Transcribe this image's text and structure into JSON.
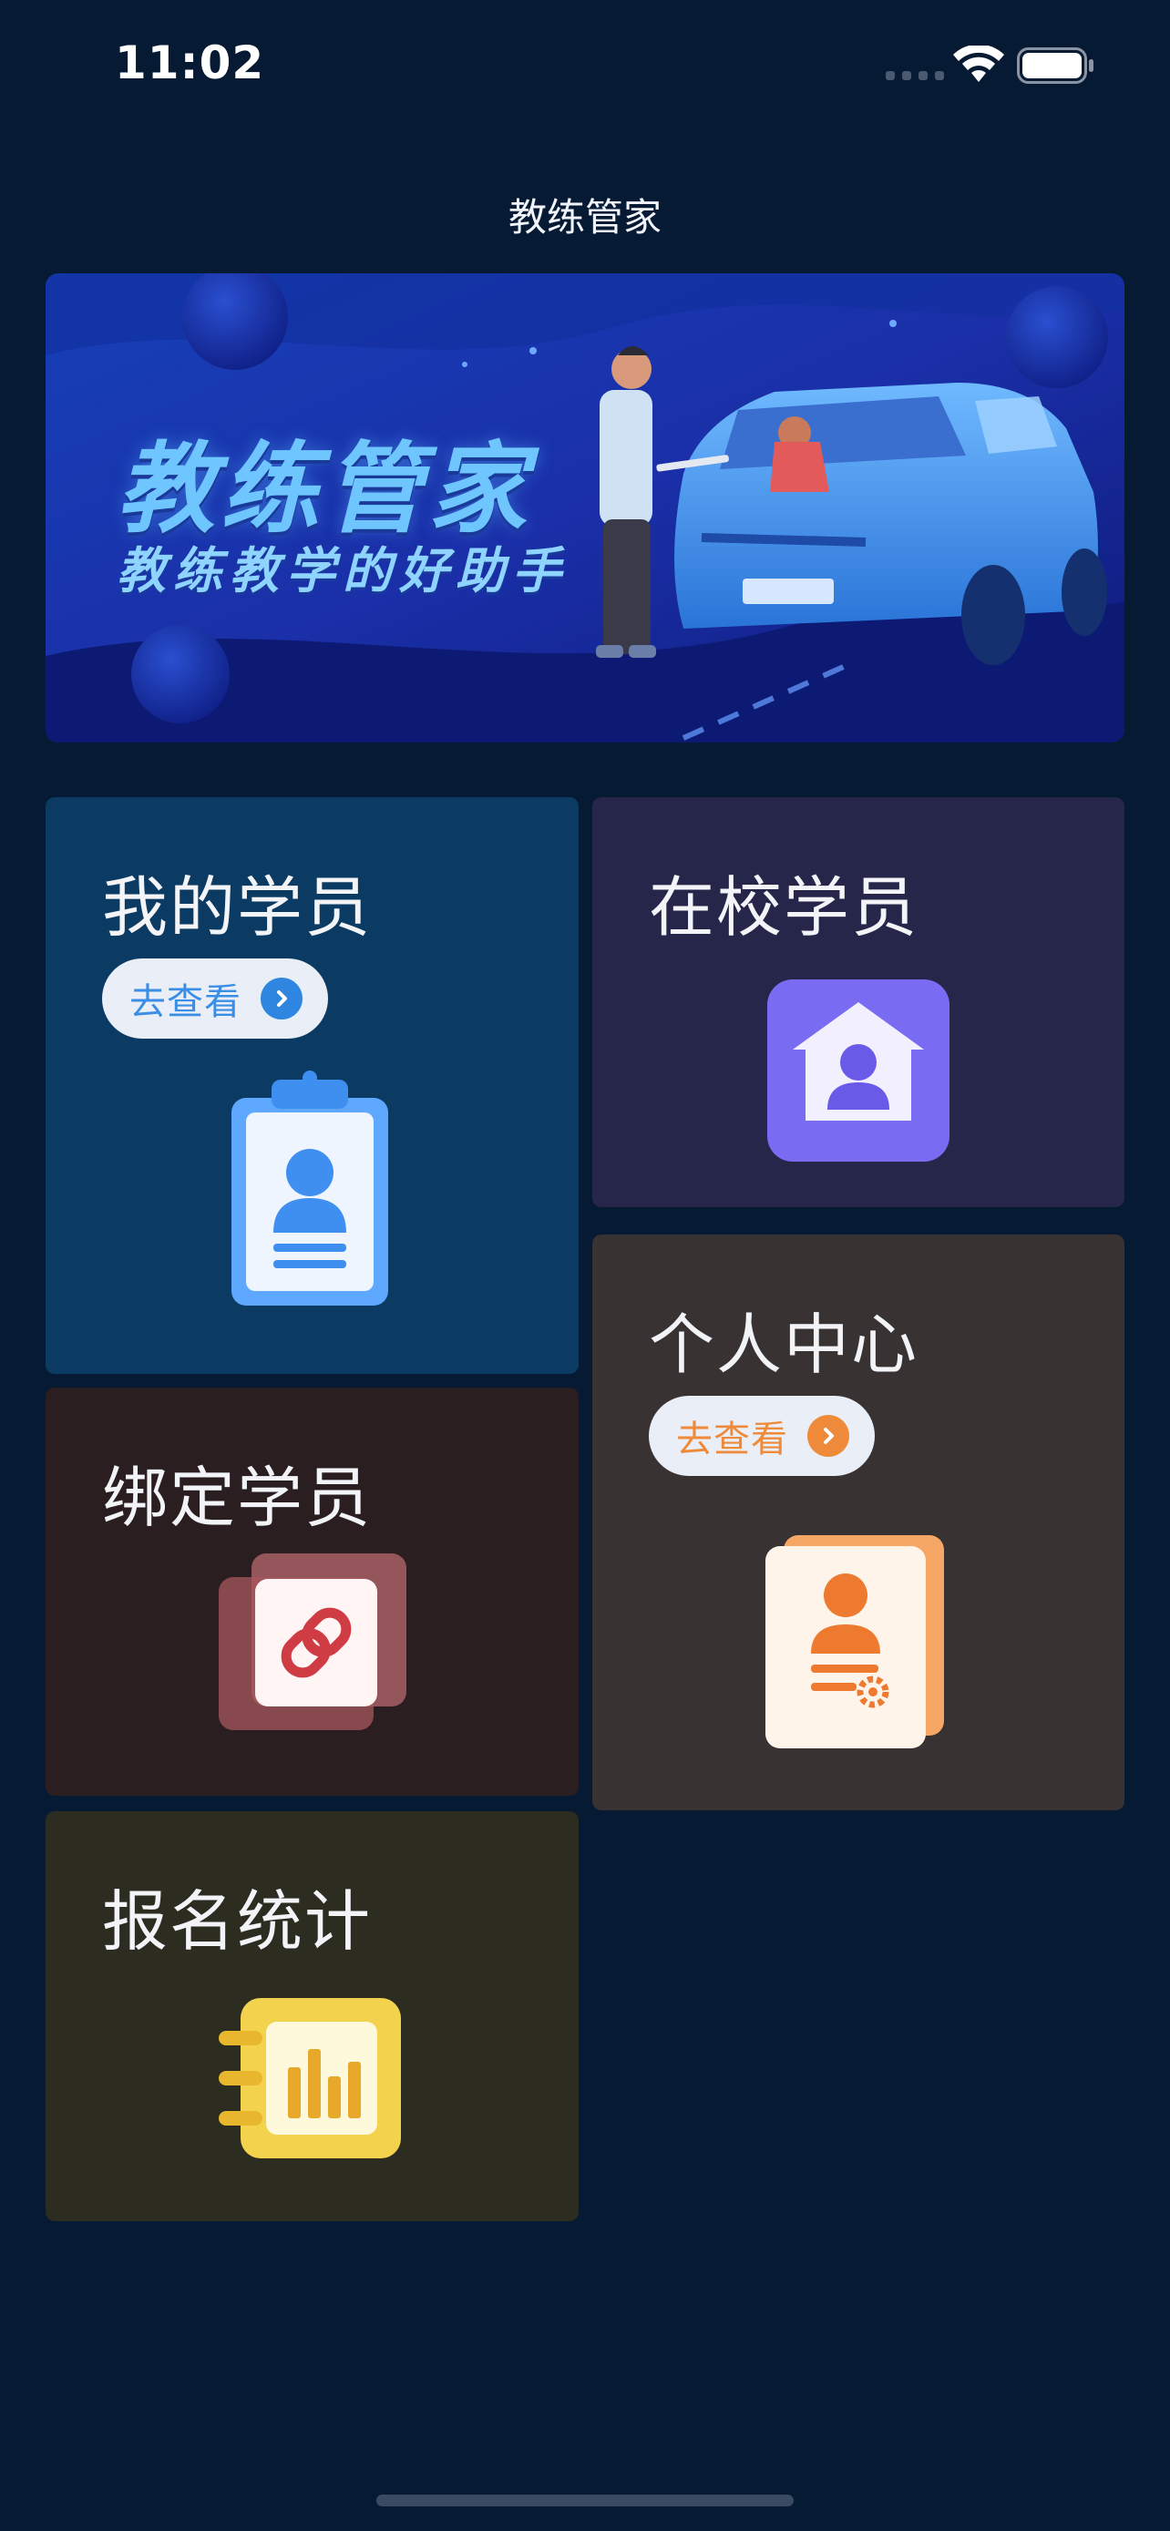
{
  "status_bar": {
    "time": "11:02"
  },
  "nav": {
    "title": "教练管家"
  },
  "banner": {
    "title": "教练管家",
    "subtitle": "教练教学的好助手"
  },
  "cards": {
    "my_students": {
      "title": "我的学员",
      "button_label": "去查看"
    },
    "in_school_students": {
      "title": "在校学员"
    },
    "bind_students": {
      "title": "绑定学员"
    },
    "personal_center": {
      "title": "个人中心",
      "button_label": "去查看"
    },
    "enrollment_stats": {
      "title": "报名统计"
    }
  },
  "colors": {
    "background": "#071a33",
    "card_my_students": "#0b3a62",
    "card_in_school": "#26264a",
    "card_bind": "#2a1e20",
    "card_personal": "#383233",
    "card_stats": "#2c2c21",
    "accent_blue": "#3a8ee6",
    "accent_orange": "#ef8a3a"
  },
  "icons": {
    "my_students": "id-badge-icon",
    "in_school_students": "house-user-icon",
    "bind_students": "link-icon",
    "personal_center": "user-settings-icon",
    "enrollment_stats": "bar-chart-notebook-icon"
  }
}
